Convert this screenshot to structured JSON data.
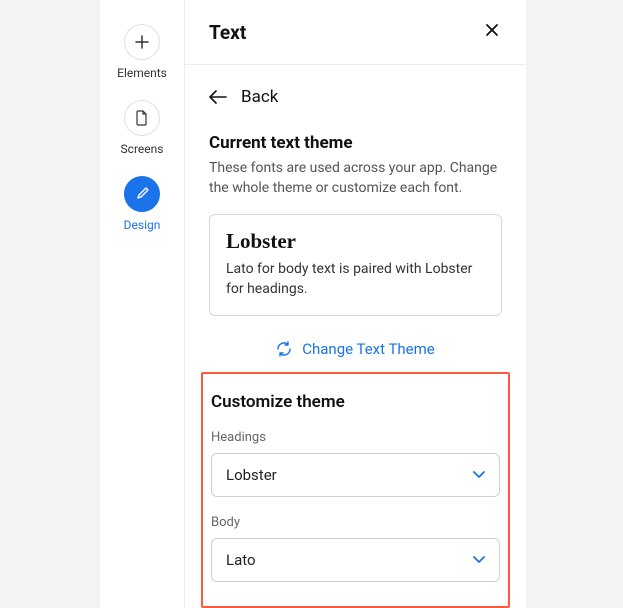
{
  "sidebar": {
    "items": [
      {
        "label": "Elements"
      },
      {
        "label": "Screens"
      },
      {
        "label": "Design"
      }
    ]
  },
  "panel": {
    "title": "Text",
    "back_label": "Back",
    "current_theme": {
      "heading": "Current text theme",
      "description": "These fonts are used across your app. Change the whole theme or customize each font.",
      "card_name": "Lobster",
      "card_desc": "Lato for body text is paired with Lobster for headings."
    },
    "change_theme_label": "Change Text Theme",
    "customize": {
      "heading": "Customize theme",
      "headings_label": "Headings",
      "headings_value": "Lobster",
      "body_label": "Body",
      "body_value": "Lato"
    }
  }
}
